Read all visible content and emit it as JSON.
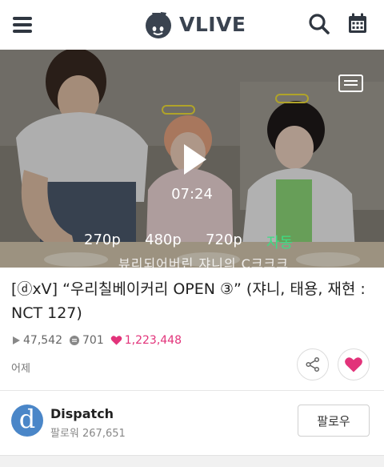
{
  "header": {
    "brand": "VLIVE",
    "menu_icon": "hamburger-menu-icon",
    "search_icon": "search-icon",
    "calendar_icon": "calendar-icon"
  },
  "video": {
    "duration": "07:24",
    "qualities": [
      "270p",
      "480p",
      "720p",
      "자동"
    ],
    "selected_quality": "자동",
    "subtitle_overlay": "뷰리되어버린 쟈니의 C크크크",
    "accent_color": "#3ddc84"
  },
  "info": {
    "title": "[ⓓxV] “우리칠베이커리 OPEN ③” (쟈니, 태용, 재현 : NCT 127)",
    "views": "47,542",
    "comments": "701",
    "likes": "1,223,448",
    "date": "어제",
    "like_color": "#e2337a"
  },
  "channel": {
    "avatar_letter": "d",
    "name": "Dispatch",
    "followers": "팔로워 267,651",
    "follow_label": "팔로우"
  }
}
